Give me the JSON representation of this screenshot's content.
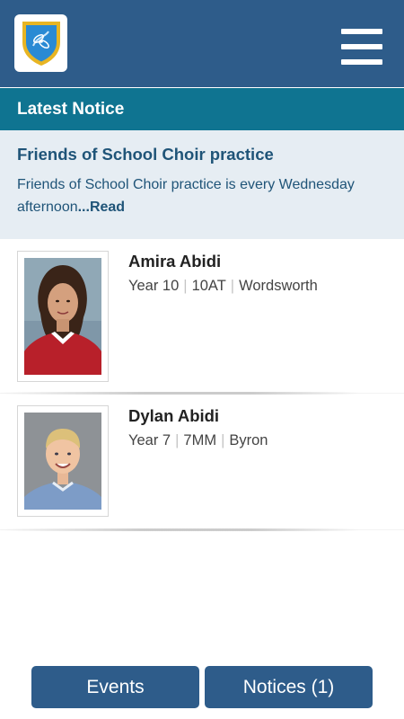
{
  "header": {
    "logo_icon": "school-crest-icon",
    "menu_icon": "hamburger-menu-icon",
    "colors": {
      "bar": "#2e5c8a",
      "section": "#0f7491",
      "notice_bg": "#e6edf3",
      "notice_text": "#1f5478"
    }
  },
  "latest_notice": {
    "heading": "Latest Notice",
    "title": "Friends of School Choir practice",
    "body": "Friends of School Choir practice is every Wednesday afternoon",
    "more": "...Read"
  },
  "students": [
    {
      "name": "Amira Abidi",
      "year": "Year 10",
      "class": "10AT",
      "house": "Wordsworth"
    },
    {
      "name": "Dylan Abidi",
      "year": "Year 7",
      "class": "7MM",
      "house": "Byron"
    }
  ],
  "bottom_nav": {
    "events_label": "Events",
    "notices_label": "Notices (1)"
  }
}
